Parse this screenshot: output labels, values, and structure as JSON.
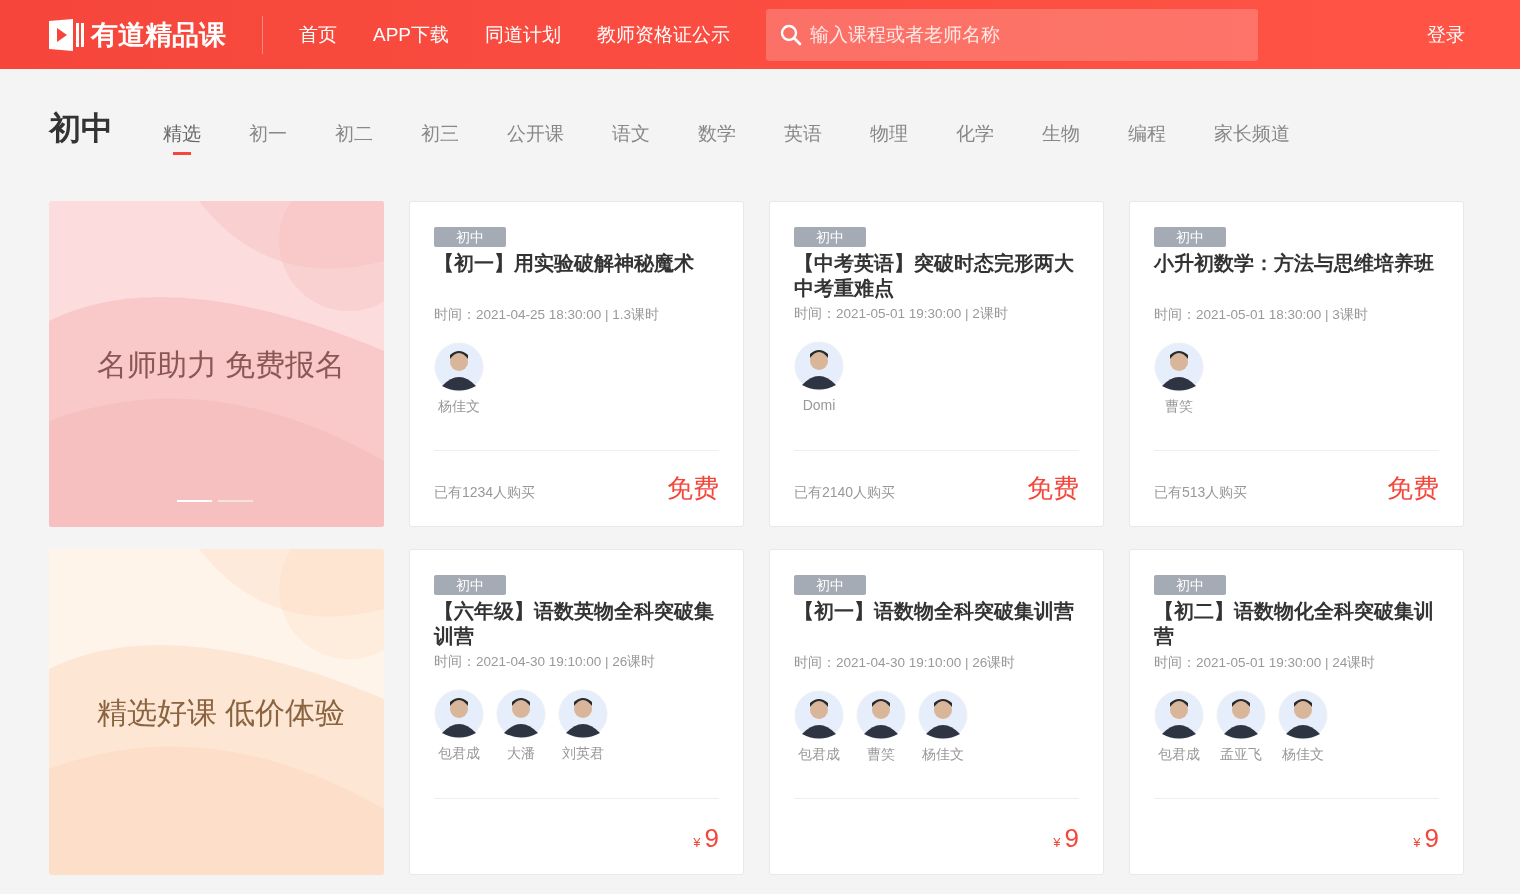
{
  "header": {
    "logo": "有道精品课",
    "nav": [
      "首页",
      "APP下载",
      "同道计划",
      "教师资格证公示"
    ],
    "search": {
      "placeholder": "输入课程或者老师名称"
    },
    "login": "登录"
  },
  "section": {
    "title": "初中",
    "tabs": [
      {
        "label": "精选",
        "selected": true
      },
      {
        "label": "初一",
        "selected": false
      },
      {
        "label": "初二",
        "selected": false
      },
      {
        "label": "初三",
        "selected": false
      },
      {
        "label": "公开课",
        "selected": false
      },
      {
        "label": "语文",
        "selected": false
      },
      {
        "label": "数学",
        "selected": false
      },
      {
        "label": "英语",
        "selected": false
      },
      {
        "label": "物理",
        "selected": false
      },
      {
        "label": "化学",
        "selected": false
      },
      {
        "label": "生物",
        "selected": false
      },
      {
        "label": "编程",
        "selected": false
      },
      {
        "label": "家长频道",
        "selected": false
      }
    ]
  },
  "rows": [
    {
      "banner": {
        "kind": "pink",
        "text": "名师助力 免费报名",
        "dots": [
          {
            "selected": true
          },
          {
            "selected": false
          }
        ]
      },
      "courses": [
        {
          "tag": "初中",
          "title": "【初一】用实验破解神秘魔术",
          "meta": "时间：2021-04-25 18:30:00 | 1.3课时",
          "teachers": [
            "杨佳文"
          ],
          "buyers": "已有1234人购买",
          "price": {
            "kind": "free",
            "text": "免费"
          }
        },
        {
          "tag": "初中",
          "title": "【中考英语】突破时态完形两大中考重难点",
          "meta": "时间：2021-05-01 19:30:00 | 2课时",
          "teachers": [
            "Domi"
          ],
          "buyers": "已有2140人购买",
          "price": {
            "kind": "free",
            "text": "免费"
          }
        },
        {
          "tag": "初中",
          "title": "小升初数学：方法与思维培养班",
          "meta": "时间：2021-05-01 18:30:00 | 3课时",
          "teachers": [
            "曹笑"
          ],
          "buyers": "已有513人购买",
          "price": {
            "kind": "free",
            "text": "免费"
          }
        }
      ]
    },
    {
      "banner": {
        "kind": "peach",
        "text": "精选好课 低价体验"
      },
      "courses": [
        {
          "tag": "初中",
          "title": "【六年级】语数英物全科突破集训营",
          "meta": "时间：2021-04-30 19:10:00 | 26课时",
          "teachers": [
            "包君成",
            "大潘",
            "刘英君"
          ],
          "price": {
            "kind": "paid",
            "currency": "¥",
            "amount": "9"
          }
        },
        {
          "tag": "初中",
          "title": "【初一】语数物全科突破集训营",
          "meta": "时间：2021-04-30 19:10:00 | 26课时",
          "teachers": [
            "包君成",
            "曹笑",
            "杨佳文"
          ],
          "price": {
            "kind": "paid",
            "currency": "¥",
            "amount": "9"
          }
        },
        {
          "tag": "初中",
          "title": "【初二】语数物化全科突破集训营",
          "meta": "时间：2021-05-01 19:30:00 | 24课时",
          "teachers": [
            "包君成",
            "孟亚飞",
            "杨佳文"
          ],
          "price": {
            "kind": "paid",
            "currency": "¥",
            "amount": "9"
          }
        }
      ]
    }
  ]
}
